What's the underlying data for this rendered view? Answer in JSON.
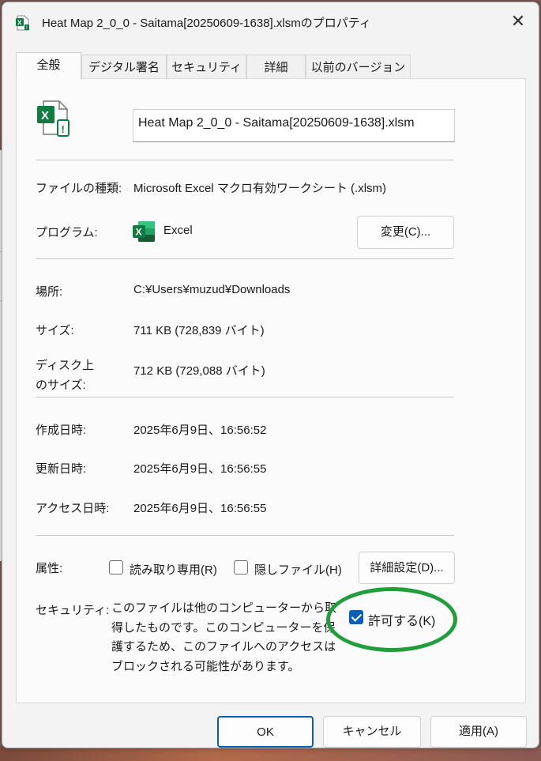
{
  "window": {
    "title": "Heat Map 2_0_0 - Saitama[20250609-1638].xlsmのプロパティ",
    "close_glyph": "✕"
  },
  "tabs": [
    {
      "label": "全般",
      "active": true
    },
    {
      "label": "デジタル署名"
    },
    {
      "label": "セキュリティ"
    },
    {
      "label": "詳細"
    },
    {
      "label": "以前のバージョン"
    }
  ],
  "general": {
    "filename": "Heat Map 2_0_0 - Saitama[20250609-1638].xlsm",
    "file_type_label": "ファイルの種類:",
    "file_type_value": "Microsoft Excel マクロ有効ワークシート (.xlsm)",
    "program_label": "プログラム:",
    "program_value": "Excel",
    "change_button": "変更(C)...",
    "location_label": "場所:",
    "location_value": "C:¥Users¥muzud¥Downloads",
    "size_label": "サイズ:",
    "size_value": "711 KB (728,839 バイト)",
    "disk_size_label_line1": "ディスク上",
    "disk_size_label_line2": "のサイズ:",
    "disk_size_value": "712 KB (729,088 バイト)",
    "created_label": "作成日時:",
    "created_value": "2025年6月9日、16:56:52",
    "modified_label": "更新日時:",
    "modified_value": "2025年6月9日、16:56:55",
    "accessed_label": "アクセス日時:",
    "accessed_value": "2025年6月9日、16:56:55",
    "attributes_label": "属性:",
    "readonly_label": "読み取り専用(R)",
    "hidden_label": "隠しファイル(H)",
    "advanced_button": "詳細設定(D)...",
    "security_label": "セキュリティ:",
    "security_text": "このファイルは他のコンピューターから取得したものです。このコンピューターを保護するため、このファイルへのアクセスはブロックされる可能性があります。",
    "unblock_label": "許可する(K)",
    "unblock_checked": true
  },
  "footer": {
    "ok": "OK",
    "cancel": "キャンセル",
    "apply": "適用(A)"
  },
  "icons": {
    "window": "excel-macro-file-icon",
    "file": "excel-macro-file-icon",
    "program": "excel-app-icon"
  },
  "colors": {
    "excel_green": "#107c41",
    "checkbox_blue": "#0a5fb4",
    "annotation_green": "#1f9e3a"
  }
}
